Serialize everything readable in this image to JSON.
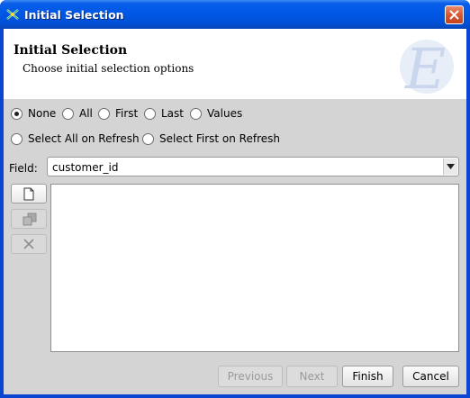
{
  "window": {
    "title": "Initial Selection",
    "app_icon": "wizard-icon",
    "close_icon": "close-icon"
  },
  "header": {
    "title": "Initial Selection",
    "subtitle": "Choose initial selection options",
    "logo_letter": "E"
  },
  "selection_options": [
    {
      "label": "None",
      "checked": true
    },
    {
      "label": "All",
      "checked": false
    },
    {
      "label": "First",
      "checked": false
    },
    {
      "label": "Last",
      "checked": false
    },
    {
      "label": "Values",
      "checked": false
    }
  ],
  "refresh_options": [
    {
      "label": "Select All on Refresh",
      "checked": false
    },
    {
      "label": "Select First on Refresh",
      "checked": false
    }
  ],
  "field": {
    "label": "Field:",
    "value": "customer_id"
  },
  "toolbar": {
    "new_icon": "new-document-icon",
    "copy_icon": "copy-icon",
    "delete_icon": "delete-icon"
  },
  "buttons": {
    "previous": "Previous",
    "next": "Next",
    "finish": "Finish",
    "cancel": "Cancel"
  },
  "colors": {
    "titlebar": "#0058e6",
    "dialog_bg": "#d4d4d4",
    "close_button": "#d9562f"
  }
}
